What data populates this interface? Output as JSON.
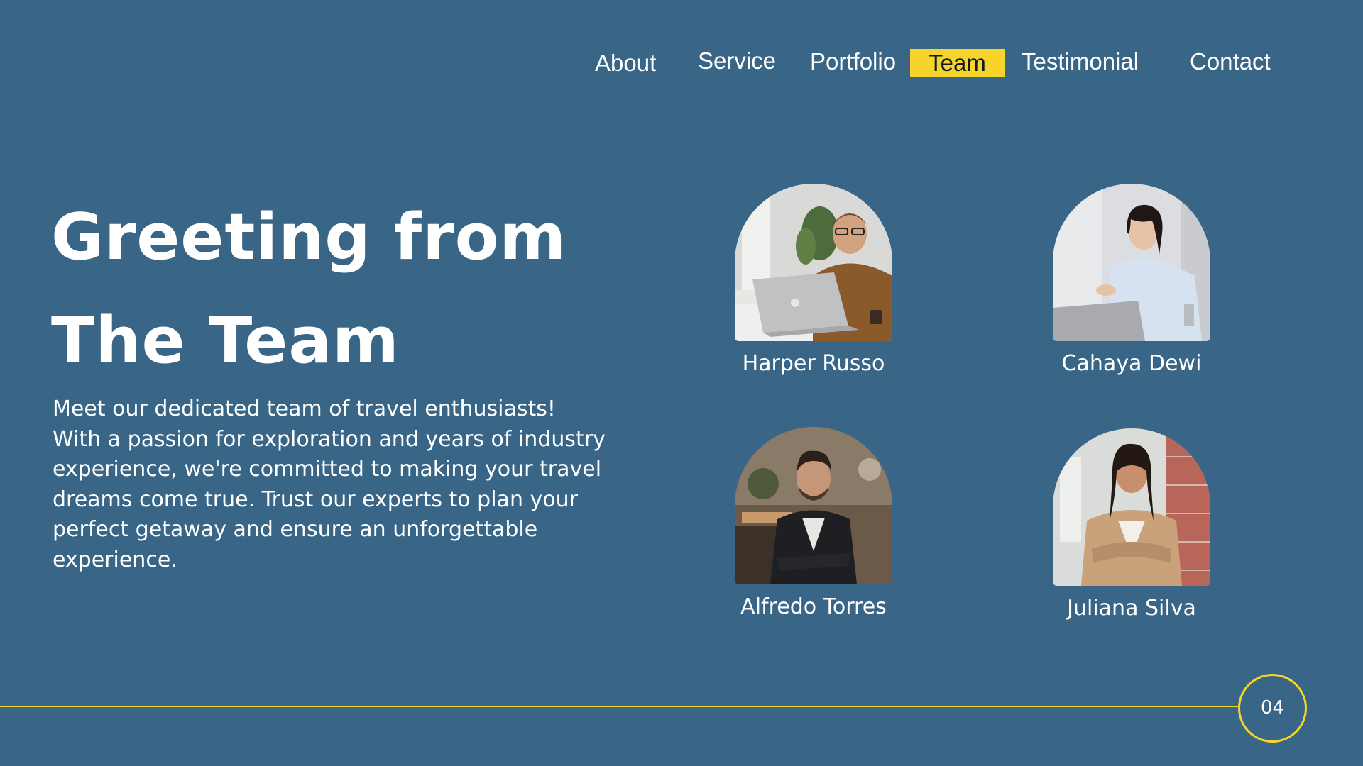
{
  "nav": {
    "items": [
      {
        "label": "About"
      },
      {
        "label": "Service"
      },
      {
        "label": "Portfolio"
      },
      {
        "label": "Team",
        "active": true
      },
      {
        "label": "Testimonial"
      },
      {
        "label": "Contact"
      }
    ],
    "active_color": "#f7d42a"
  },
  "hero": {
    "title_line1": "Greeting from",
    "title_line2": "The Team",
    "paragraph": "Meet our dedicated team of travel enthusiasts! With a passion for exploration and years of industry experience, we're committed to making your travel dreams come true. Trust our experts to plan your perfect getaway and ensure an unforgettable experience."
  },
  "team": [
    {
      "name": "Harper Russo"
    },
    {
      "name": "Cahaya Dewi"
    },
    {
      "name": "Alfredo Torres"
    },
    {
      "name": "Juliana Silva"
    }
  ],
  "footer": {
    "page_number": "04"
  },
  "colors": {
    "background": "#396687",
    "accent": "#f7d42a",
    "text": "#ffffff"
  }
}
